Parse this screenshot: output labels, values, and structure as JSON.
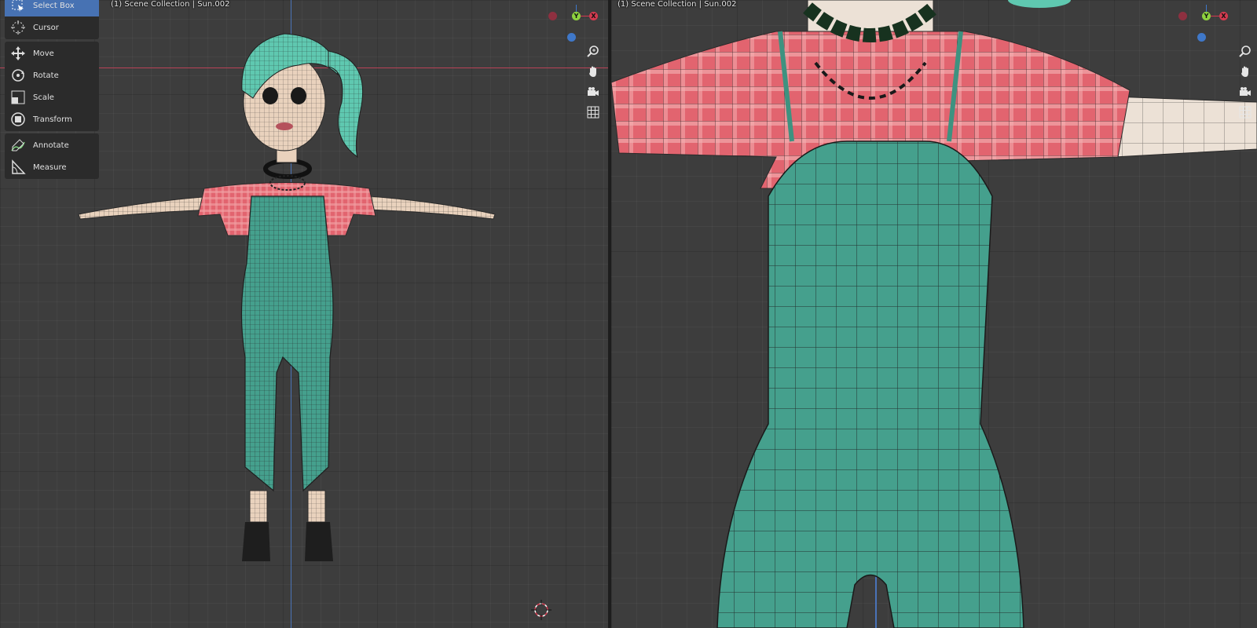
{
  "viewport_left": {
    "scene_label": "(1) Scene Collection | Sun.002",
    "gizmo": {
      "y_label": "Y",
      "x_label": "X"
    }
  },
  "viewport_right": {
    "scene_label": "(1) Scene Collection | Sun.002",
    "gizmo": {
      "y_label": "Y",
      "x_label": "X"
    }
  },
  "toolbar": {
    "groups": [
      [
        {
          "label": "Select Box",
          "icon": "select-box-icon",
          "active": true
        },
        {
          "label": "Cursor",
          "icon": "cursor-icon"
        }
      ],
      [
        {
          "label": "Move",
          "icon": "move-icon"
        },
        {
          "label": "Rotate",
          "icon": "rotate-icon"
        },
        {
          "label": "Scale",
          "icon": "scale-icon"
        },
        {
          "label": "Transform",
          "icon": "transform-icon"
        }
      ],
      [
        {
          "label": "Annotate",
          "icon": "annotate-icon"
        },
        {
          "label": "Measure",
          "icon": "measure-icon"
        }
      ]
    ]
  },
  "nav_buttons": [
    "zoom-icon",
    "hand-pan-icon",
    "camera-icon",
    "grid-icon"
  ],
  "colors": {
    "active_tool": "#4772b3",
    "axis_x": "#d33a4f",
    "axis_y": "#8ed23f",
    "axis_z": "#3f78c9",
    "hair": "#5fc8b0",
    "shirt": "#e2646f",
    "overalls": "#45a08d",
    "skin": "#e9d2bd"
  }
}
